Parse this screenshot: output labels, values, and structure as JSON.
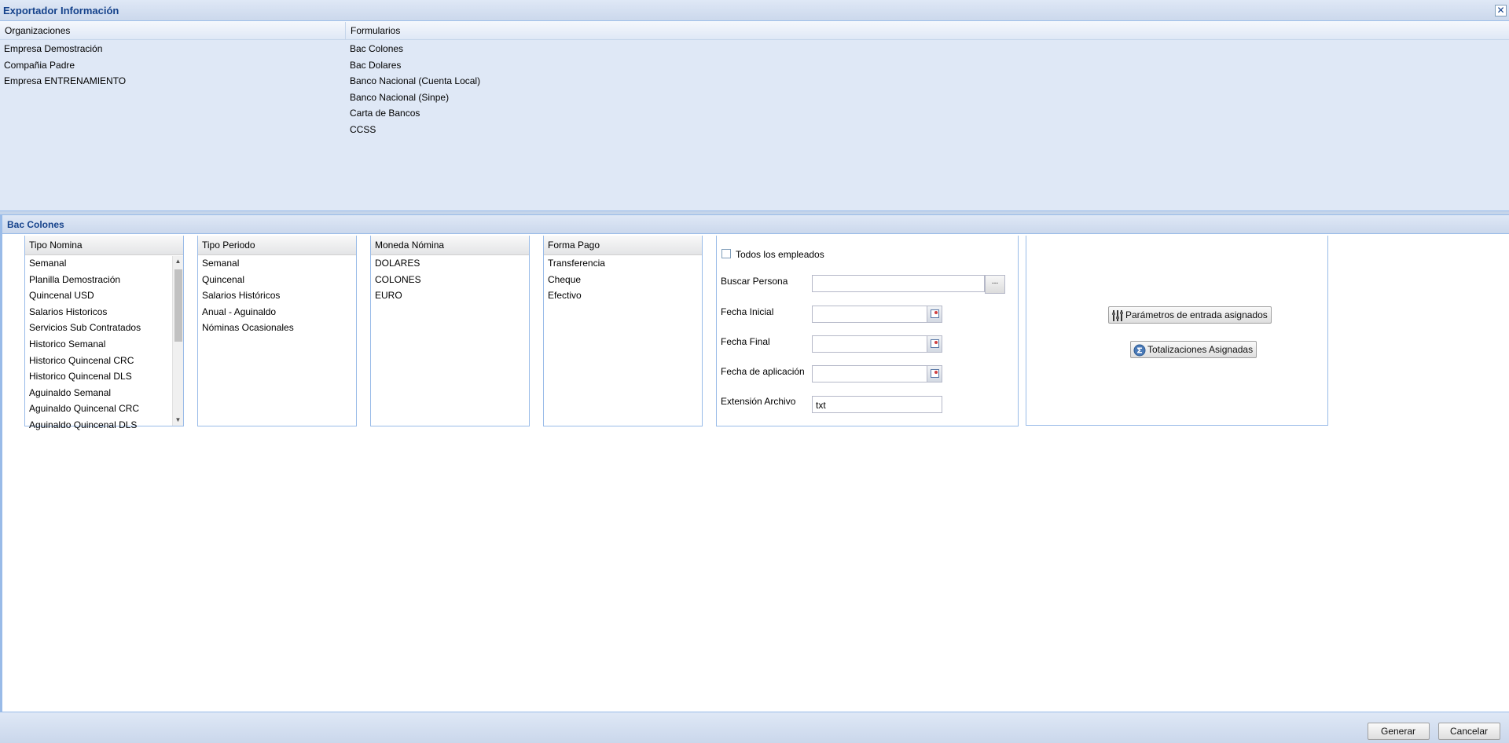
{
  "window": {
    "title": "Exportador Información",
    "close_glyph": "✕"
  },
  "top": {
    "col_headers": {
      "organizaciones": "Organizaciones",
      "formularios": "Formularios"
    },
    "organizaciones": [
      "Empresa Demostración",
      "Compañia Padre",
      "Empresa ENTRENAMIENTO"
    ],
    "formularios": [
      "Bac Colones",
      "Bac Dolares",
      "Banco Nacional (Cuenta Local)",
      "Banco Nacional (Sinpe)",
      "Carta de Bancos",
      "CCSS"
    ]
  },
  "panel": {
    "title": "Bac Colones",
    "tipo_nomina": {
      "header": "Tipo Nomina",
      "items": [
        "Semanal",
        "Planilla Demostración",
        "Quincenal USD",
        "Salarios Historicos",
        "Servicios Sub Contratados",
        "Historico Semanal",
        "Historico Quincenal CRC",
        "Historico Quincenal DLS",
        "Aguinaldo Semanal",
        "Aguinaldo Quincenal CRC",
        "Aguinaldo Quincenal DLS"
      ]
    },
    "tipo_periodo": {
      "header": "Tipo Periodo",
      "items": [
        "Semanal",
        "Quincenal",
        "Salarios Históricos",
        "Anual - Aguinaldo",
        "Nóminas Ocasionales"
      ]
    },
    "moneda_nomina": {
      "header": "Moneda Nómina",
      "items": [
        "DOLARES",
        "COLONES",
        "EURO"
      ]
    },
    "forma_pago": {
      "header": "Forma Pago",
      "items": [
        "Transferencia",
        "Cheque",
        "Efectivo"
      ]
    },
    "filters": {
      "todos_label": "Todos los empleados",
      "buscar_label": "Buscar Persona",
      "buscar_value": "",
      "buscar_button": "...",
      "fecha_inicial_label": "Fecha Inicial",
      "fecha_final_label": "Fecha Final",
      "fecha_aplicacion_label": "Fecha de aplicación",
      "extension_label": "Extensión Archivo",
      "extension_value": "txt"
    },
    "actions": {
      "parametros_label": "Parámetros de entrada asignados",
      "totalizaciones_label": "Totalizaciones Asignadas"
    }
  },
  "footer": {
    "generar_label": "Generar",
    "cancelar_label": "Cancelar"
  },
  "icons": {
    "calendar": "calendar-icon",
    "sliders": "sliders-icon",
    "sigma": "sigma-icon",
    "close": "close-icon"
  },
  "colors": {
    "accent": "#15428b",
    "panel_bg": "#dfe8f6",
    "border": "#99bbe8"
  }
}
